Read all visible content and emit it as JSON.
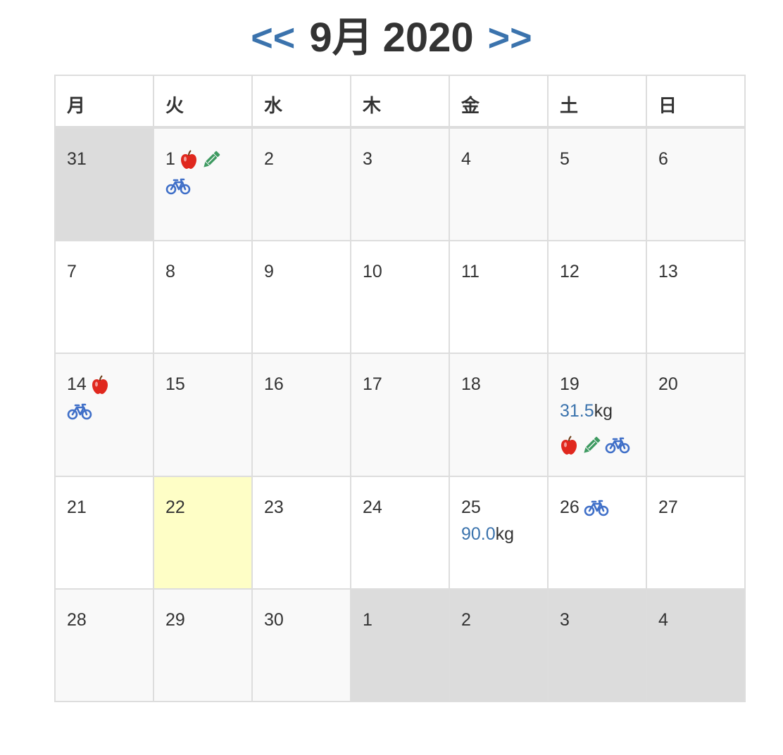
{
  "header": {
    "prev": "<<",
    "month": "9月",
    "year": "2020",
    "next": ">>"
  },
  "weekdays": [
    "月",
    "火",
    "水",
    "木",
    "金",
    "土",
    "日"
  ],
  "weeks": [
    {
      "row": "r1",
      "style": "striped",
      "days": [
        {
          "d": "31",
          "other": true
        },
        {
          "d": "1",
          "inline_icons": [
            "apple-icon",
            "pencil-icon"
          ],
          "icons_newline": [
            "bicycle-icon"
          ]
        },
        {
          "d": "2"
        },
        {
          "d": "3"
        },
        {
          "d": "4"
        },
        {
          "d": "5"
        },
        {
          "d": "6"
        }
      ]
    },
    {
      "row": "r2",
      "style": "plain",
      "days": [
        {
          "d": "7"
        },
        {
          "d": "8"
        },
        {
          "d": "9"
        },
        {
          "d": "10"
        },
        {
          "d": "11"
        },
        {
          "d": "12"
        },
        {
          "d": "13"
        }
      ]
    },
    {
      "row": "r3",
      "style": "striped",
      "days": [
        {
          "d": "14",
          "inline_icons": [
            "apple-icon"
          ],
          "icons_newline": [
            "bicycle-icon"
          ]
        },
        {
          "d": "15"
        },
        {
          "d": "16"
        },
        {
          "d": "17"
        },
        {
          "d": "18"
        },
        {
          "d": "19",
          "weight": "31.5",
          "unit": "kg",
          "icons_row": [
            "apple-icon",
            "pencil-icon",
            "bicycle-icon"
          ]
        },
        {
          "d": "20"
        }
      ]
    },
    {
      "row": "r4",
      "style": "plain",
      "days": [
        {
          "d": "21"
        },
        {
          "d": "22",
          "today": true
        },
        {
          "d": "23"
        },
        {
          "d": "24"
        },
        {
          "d": "25",
          "weight": "90.0",
          "unit": "kg"
        },
        {
          "d": "26",
          "inline_icons": [
            "bicycle-icon"
          ]
        },
        {
          "d": "27"
        }
      ]
    },
    {
      "row": "r5",
      "style": "striped",
      "days": [
        {
          "d": "28"
        },
        {
          "d": "29"
        },
        {
          "d": "30"
        },
        {
          "d": "1",
          "other": true
        },
        {
          "d": "2",
          "other": true
        },
        {
          "d": "3",
          "other": true
        },
        {
          "d": "4",
          "other": true
        }
      ]
    }
  ],
  "colors": {
    "link": "#3b73ad",
    "apple": "#e0281e",
    "pencil": "#3e9a61",
    "bicycle": "#3f6fc8",
    "other_month": "#dcdcdc",
    "today": "#fefec6"
  }
}
